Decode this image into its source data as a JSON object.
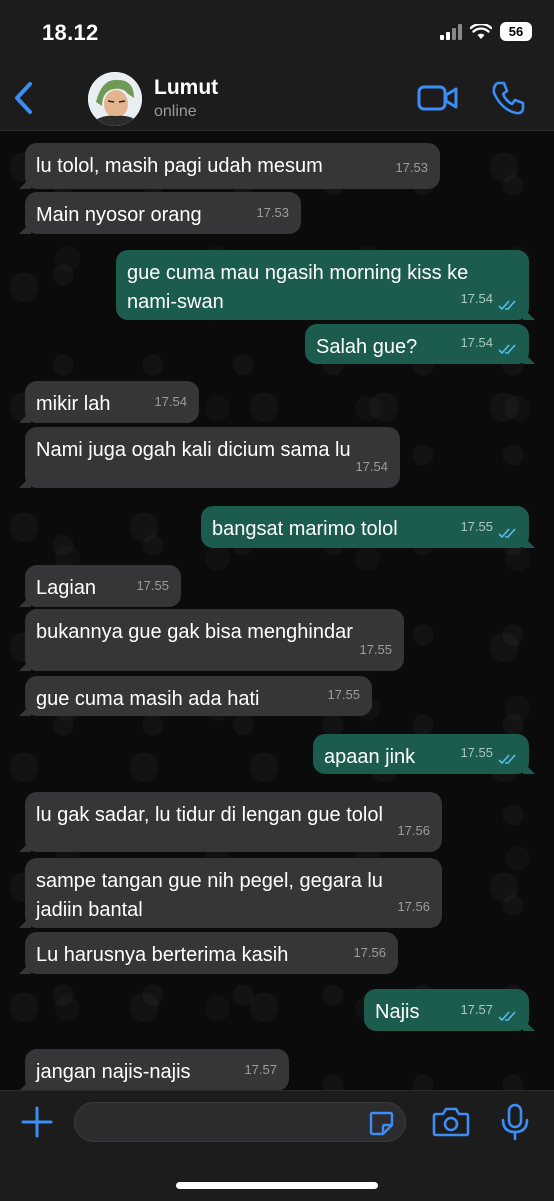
{
  "status_bar": {
    "time": "18.12",
    "battery": "56"
  },
  "header": {
    "contact_name": "Lumut",
    "contact_status": "online"
  },
  "colors": {
    "accent": "#3a8ef6",
    "incoming_bubble": "#363638",
    "outgoing_bubble": "#1c5c4f",
    "read_ticks": "#53bdeb"
  },
  "messages": [
    {
      "dir": "in",
      "text": "lu tolol, masih pagi udah mesum",
      "time": "17.53"
    },
    {
      "dir": "in",
      "text": "Main nyosor orang",
      "time": "17.53"
    },
    {
      "dir": "out",
      "text": "gue cuma mau ngasih morning kiss ke\nnami-swan",
      "time": "17.54"
    },
    {
      "dir": "out",
      "text": "Salah gue?",
      "time": "17.54"
    },
    {
      "dir": "in",
      "text": "mikir lah",
      "time": "17.54"
    },
    {
      "dir": "in",
      "text": "Nami juga ogah kali dicium sama lu",
      "time": "17.54"
    },
    {
      "dir": "out",
      "text": "bangsat marimo tolol",
      "time": "17.55"
    },
    {
      "dir": "in",
      "text": "Lagian",
      "time": "17.55"
    },
    {
      "dir": "in",
      "text": "bukannya gue gak bisa menghindar",
      "time": "17.55"
    },
    {
      "dir": "in",
      "text": "gue cuma masih ada hati",
      "time": "17.55"
    },
    {
      "dir": "out",
      "text": "apaan jink",
      "time": "17.55"
    },
    {
      "dir": "in",
      "text": "lu gak sadar, lu tidur di lengan gue tolol",
      "time": "17.56"
    },
    {
      "dir": "in",
      "text": "sampe tangan gue nih pegel, gegara lu\njadiin bantal",
      "time": "17.56"
    },
    {
      "dir": "in",
      "text": "Lu harusnya berterima kasih",
      "time": "17.56"
    },
    {
      "dir": "out",
      "text": "Najis",
      "time": "17.57"
    },
    {
      "dir": "in",
      "text": "jangan najis-najis",
      "time": "17.57"
    }
  ],
  "composer": {
    "input_value": "",
    "input_placeholder": ""
  }
}
